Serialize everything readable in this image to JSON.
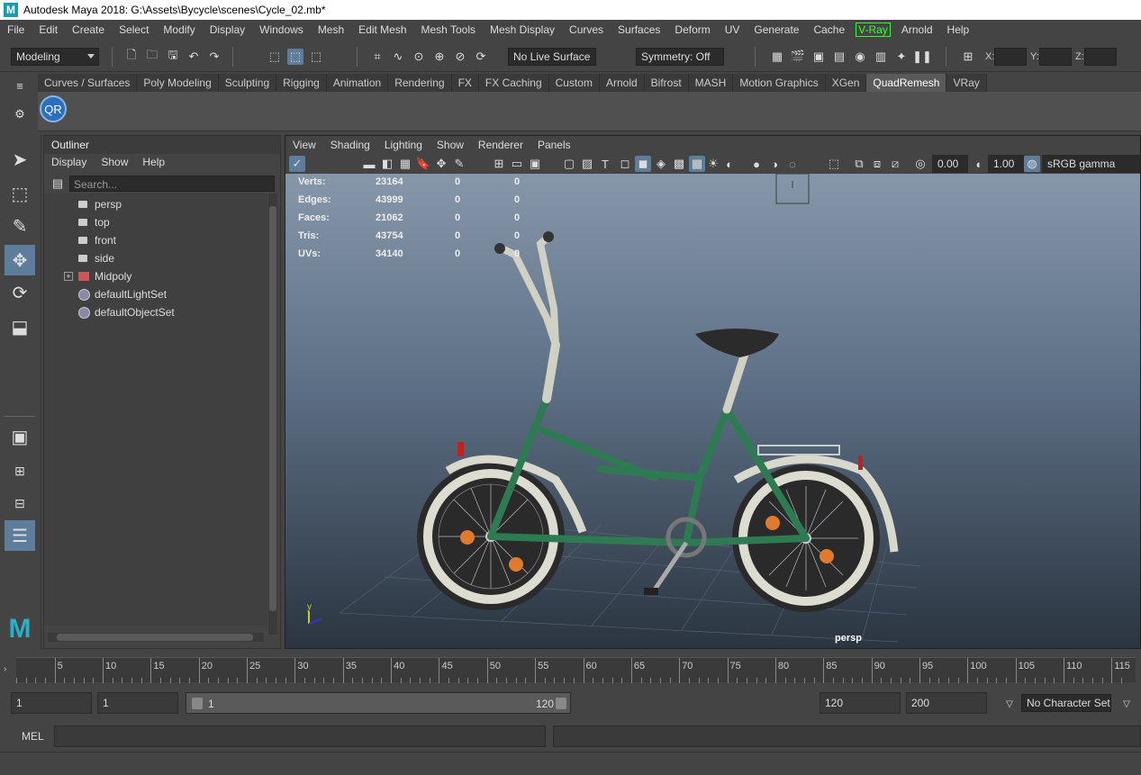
{
  "titlebar": {
    "title": "Autodesk Maya 2018: G:\\Assets\\Bycycle\\scenes\\Cycle_02.mb*"
  },
  "menubar": [
    "File",
    "Edit",
    "Create",
    "Select",
    "Modify",
    "Display",
    "Windows",
    "Mesh",
    "Edit Mesh",
    "Mesh Tools",
    "Mesh Display",
    "Curves",
    "Surfaces",
    "Deform",
    "UV",
    "Generate",
    "Cache",
    "V-Ray",
    "Arnold",
    "Help"
  ],
  "statusline": {
    "menuset": "Modeling",
    "live_surface": "No Live Surface",
    "symmetry": "Symmetry: Off",
    "x_label": "X:",
    "y_label": "Y:",
    "z_label": "Z:"
  },
  "shelf": {
    "tabs": [
      "Curves / Surfaces",
      "Poly Modeling",
      "Sculpting",
      "Rigging",
      "Animation",
      "Rendering",
      "FX",
      "FX Caching",
      "Custom",
      "Arnold",
      "Bifrost",
      "MASH",
      "Motion Graphics",
      "XGen",
      "QuadRemesh",
      "VRay"
    ],
    "active_tab": "QuadRemesh",
    "qr_button": "QR"
  },
  "outliner": {
    "title": "Outliner",
    "menu": [
      "Display",
      "Show",
      "Help"
    ],
    "search_placeholder": "Search...",
    "items": [
      {
        "label": "persp",
        "type": "camera"
      },
      {
        "label": "top",
        "type": "camera"
      },
      {
        "label": "front",
        "type": "camera"
      },
      {
        "label": "side",
        "type": "camera"
      },
      {
        "label": "Midpoly",
        "type": "group"
      },
      {
        "label": "defaultLightSet",
        "type": "set"
      },
      {
        "label": "defaultObjectSet",
        "type": "set"
      }
    ]
  },
  "viewport": {
    "menu": [
      "View",
      "Shading",
      "Lighting",
      "Show",
      "Renderer",
      "Panels"
    ],
    "exposure": "0.00",
    "gamma": "1.00",
    "colorspace": "sRGB gamma",
    "camera_label": "persp",
    "hud": [
      {
        "label": "Verts:",
        "v1": "23164",
        "v2": "0",
        "v3": "0"
      },
      {
        "label": "Edges:",
        "v1": "43999",
        "v2": "0",
        "v3": "0"
      },
      {
        "label": "Faces:",
        "v1": "21062",
        "v2": "0",
        "v3": "0"
      },
      {
        "label": "Tris:",
        "v1": "43754",
        "v2": "0",
        "v3": "0"
      },
      {
        "label": "UVs:",
        "v1": "34140",
        "v2": "0",
        "v3": "0"
      }
    ],
    "axis_y": "y",
    "colors": {
      "bike_frame": "#2e7a52",
      "tire": "#2a2a2a",
      "rim": "#dcdcd0",
      "reflector": "#e07a2c"
    }
  },
  "timeslider": {
    "ticks": [
      "5",
      "10",
      "15",
      "20",
      "25",
      "30",
      "35",
      "40",
      "45",
      "50",
      "55",
      "60",
      "65",
      "70",
      "75",
      "80",
      "85",
      "90",
      "95",
      "100",
      "105",
      "110",
      "115"
    ]
  },
  "range": {
    "start": "1",
    "current": "1",
    "range_start": "1",
    "range_end": "120",
    "end": "120",
    "anim_end": "200",
    "character_set": "No Character Set"
  },
  "cmdline": {
    "label": "MEL"
  }
}
